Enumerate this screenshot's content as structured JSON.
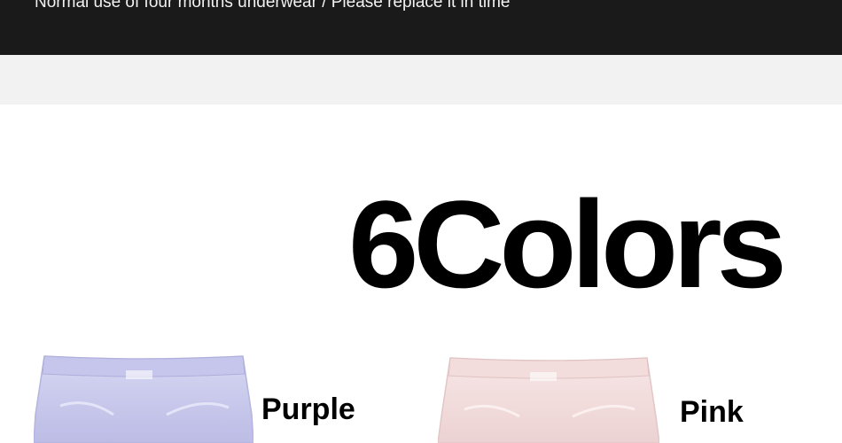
{
  "banner": {
    "text": "Normal use of four months underwear / Please replace it in time"
  },
  "heading": {
    "title": "6Colors"
  },
  "products": [
    {
      "color_name": "Purple",
      "swatch": "#c9c9ec"
    },
    {
      "color_name": "Pink",
      "swatch": "#f2dcdc"
    }
  ]
}
